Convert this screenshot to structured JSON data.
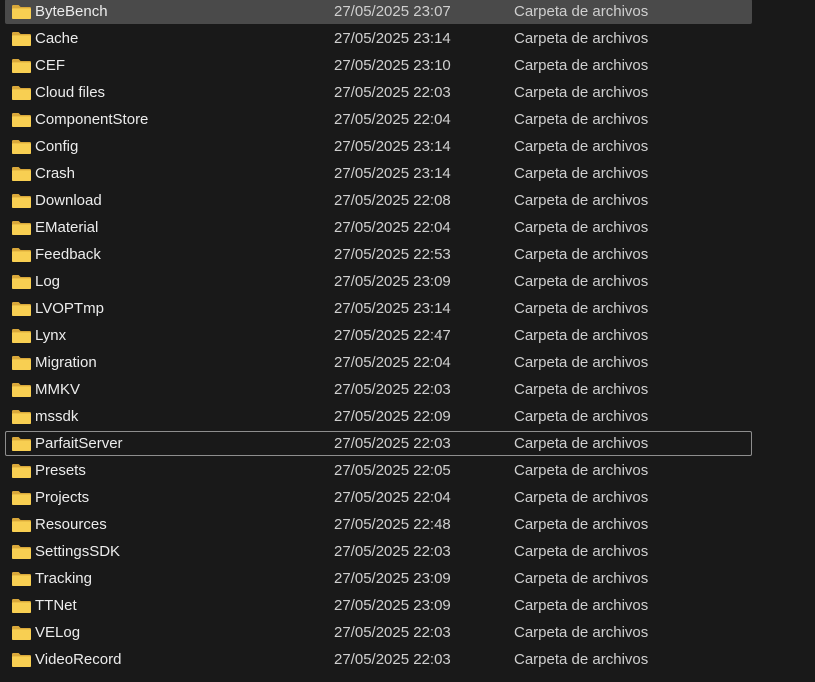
{
  "explorer": {
    "hovered_index": 0,
    "focused_index": 16,
    "icon": "folder-icon",
    "colors": {
      "background": "#191919",
      "hover_background": "#4a4a4a",
      "focus_border": "#8e8e8e",
      "folder_yellow": "#f8cf52"
    },
    "rows": [
      {
        "name": "ByteBench",
        "date": "27/05/2025 23:07",
        "type": "Carpeta de archivos"
      },
      {
        "name": "Cache",
        "date": "27/05/2025 23:14",
        "type": "Carpeta de archivos"
      },
      {
        "name": "CEF",
        "date": "27/05/2025 23:10",
        "type": "Carpeta de archivos"
      },
      {
        "name": "Cloud files",
        "date": "27/05/2025 22:03",
        "type": "Carpeta de archivos"
      },
      {
        "name": "ComponentStore",
        "date": "27/05/2025 22:04",
        "type": "Carpeta de archivos"
      },
      {
        "name": "Config",
        "date": "27/05/2025 23:14",
        "type": "Carpeta de archivos"
      },
      {
        "name": "Crash",
        "date": "27/05/2025 23:14",
        "type": "Carpeta de archivos"
      },
      {
        "name": "Download",
        "date": "27/05/2025 22:08",
        "type": "Carpeta de archivos"
      },
      {
        "name": "EMaterial",
        "date": "27/05/2025 22:04",
        "type": "Carpeta de archivos"
      },
      {
        "name": "Feedback",
        "date": "27/05/2025 22:53",
        "type": "Carpeta de archivos"
      },
      {
        "name": "Log",
        "date": "27/05/2025 23:09",
        "type": "Carpeta de archivos"
      },
      {
        "name": "LVOPTmp",
        "date": "27/05/2025 23:14",
        "type": "Carpeta de archivos"
      },
      {
        "name": "Lynx",
        "date": "27/05/2025 22:47",
        "type": "Carpeta de archivos"
      },
      {
        "name": "Migration",
        "date": "27/05/2025 22:04",
        "type": "Carpeta de archivos"
      },
      {
        "name": "MMKV",
        "date": "27/05/2025 22:03",
        "type": "Carpeta de archivos"
      },
      {
        "name": "mssdk",
        "date": "27/05/2025 22:09",
        "type": "Carpeta de archivos"
      },
      {
        "name": "ParfaitServer",
        "date": "27/05/2025 22:03",
        "type": "Carpeta de archivos"
      },
      {
        "name": "Presets",
        "date": "27/05/2025 22:05",
        "type": "Carpeta de archivos"
      },
      {
        "name": "Projects",
        "date": "27/05/2025 22:04",
        "type": "Carpeta de archivos"
      },
      {
        "name": "Resources",
        "date": "27/05/2025 22:48",
        "type": "Carpeta de archivos"
      },
      {
        "name": "SettingsSDK",
        "date": "27/05/2025 22:03",
        "type": "Carpeta de archivos"
      },
      {
        "name": "Tracking",
        "date": "27/05/2025 23:09",
        "type": "Carpeta de archivos"
      },
      {
        "name": "TTNet",
        "date": "27/05/2025 23:09",
        "type": "Carpeta de archivos"
      },
      {
        "name": "VELog",
        "date": "27/05/2025 22:03",
        "type": "Carpeta de archivos"
      },
      {
        "name": "VideoRecord",
        "date": "27/05/2025 22:03",
        "type": "Carpeta de archivos"
      }
    ]
  }
}
